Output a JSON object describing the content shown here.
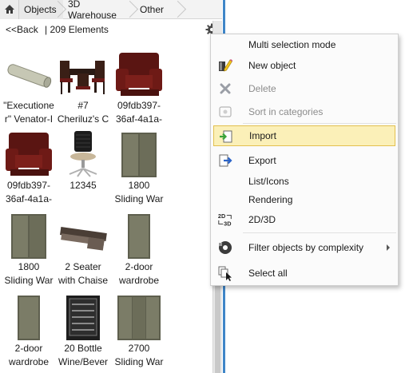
{
  "breadcrumb": {
    "items": [
      "Objects",
      "3D Warehouse",
      "Other"
    ]
  },
  "toolbar": {
    "back_label": "<<Back",
    "count_text": "| 209 Elements"
  },
  "tiles": [
    {
      "line1": "\"Executione",
      "line2": "r\" Venator-I"
    },
    {
      "line1": "#7",
      "line2": "Cheriluz's C"
    },
    {
      "line1": "09fdb397-",
      "line2": "36af-4a1a-"
    },
    {
      "line1": "09fdb397-",
      "line2": "36af-4a1a-"
    },
    {
      "line1": "12345",
      "line2": ""
    },
    {
      "line1": "1800",
      "line2": "Sliding War"
    },
    {
      "line1": "1800",
      "line2": "Sliding War"
    },
    {
      "line1": "2 Seater",
      "line2": "with Chaise"
    },
    {
      "line1": "2-door",
      "line2": "wardrobe"
    },
    {
      "line1": "2-door",
      "line2": "wardrobe"
    },
    {
      "line1": "20 Bottle",
      "line2": "Wine/Bever"
    },
    {
      "line1": "2700",
      "line2": "Sliding War"
    }
  ],
  "menu": {
    "items": [
      {
        "label": "Multi selection mode",
        "icon": "none",
        "disabled": false
      },
      {
        "label": "New object",
        "icon": "pencil-object-icon",
        "disabled": false
      },
      {
        "label": "Delete",
        "icon": "delete-x-icon",
        "disabled": true
      },
      {
        "label": "Sort in categories",
        "icon": "sort-categories-icon",
        "disabled": true
      },
      {
        "label": "Import",
        "icon": "import-icon",
        "disabled": false,
        "highlighted": true
      },
      {
        "label": "Export",
        "icon": "export-icon",
        "disabled": false
      },
      {
        "label": "List/Icons",
        "icon": "none",
        "disabled": false
      },
      {
        "label": "Rendering",
        "icon": "none",
        "disabled": false
      },
      {
        "label": "2D/3D",
        "icon": "2d-3d-icon",
        "disabled": false
      },
      {
        "label": "Filter objects by complexity",
        "icon": "filter-complexity-icon",
        "disabled": false,
        "submenu": true
      },
      {
        "label": "Select all",
        "icon": "select-all-icon",
        "disabled": false
      }
    ]
  },
  "colors": {
    "highlight_fill": "#fbf0b8",
    "highlight_border": "#e3c04f",
    "divider_blue": "#3f86c8"
  }
}
